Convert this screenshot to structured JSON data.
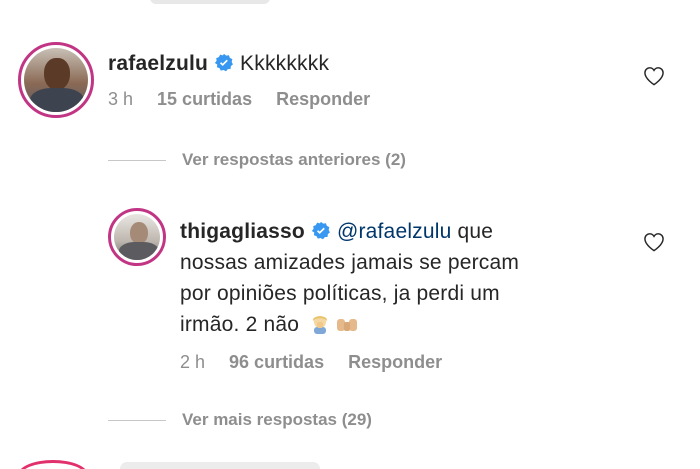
{
  "comments": [
    {
      "username": "rafaelzulu",
      "text": "Kkkkkkkk",
      "time": "3 h",
      "likes": "15 curtidas",
      "reply_label": "Responder"
    },
    {
      "username": "thigagliasso",
      "mention": "@rafaelzulu",
      "text_line1": " que",
      "text_line2": "nossas amizades jamais se percam",
      "text_line3": "por opiniões políticas, ja perdi um",
      "text_line4": "irmão. 2 não",
      "time": "2 h",
      "likes": "96 curtidas",
      "reply_label": "Responder"
    }
  ],
  "threads": {
    "previous": "Ver respostas anteriores (2)",
    "more": "Ver mais respostas (29)"
  },
  "colors": {
    "verified": "#3897f0",
    "mention": "#00376b",
    "meta": "#8e8e8e",
    "story_ring": "#c13584"
  }
}
